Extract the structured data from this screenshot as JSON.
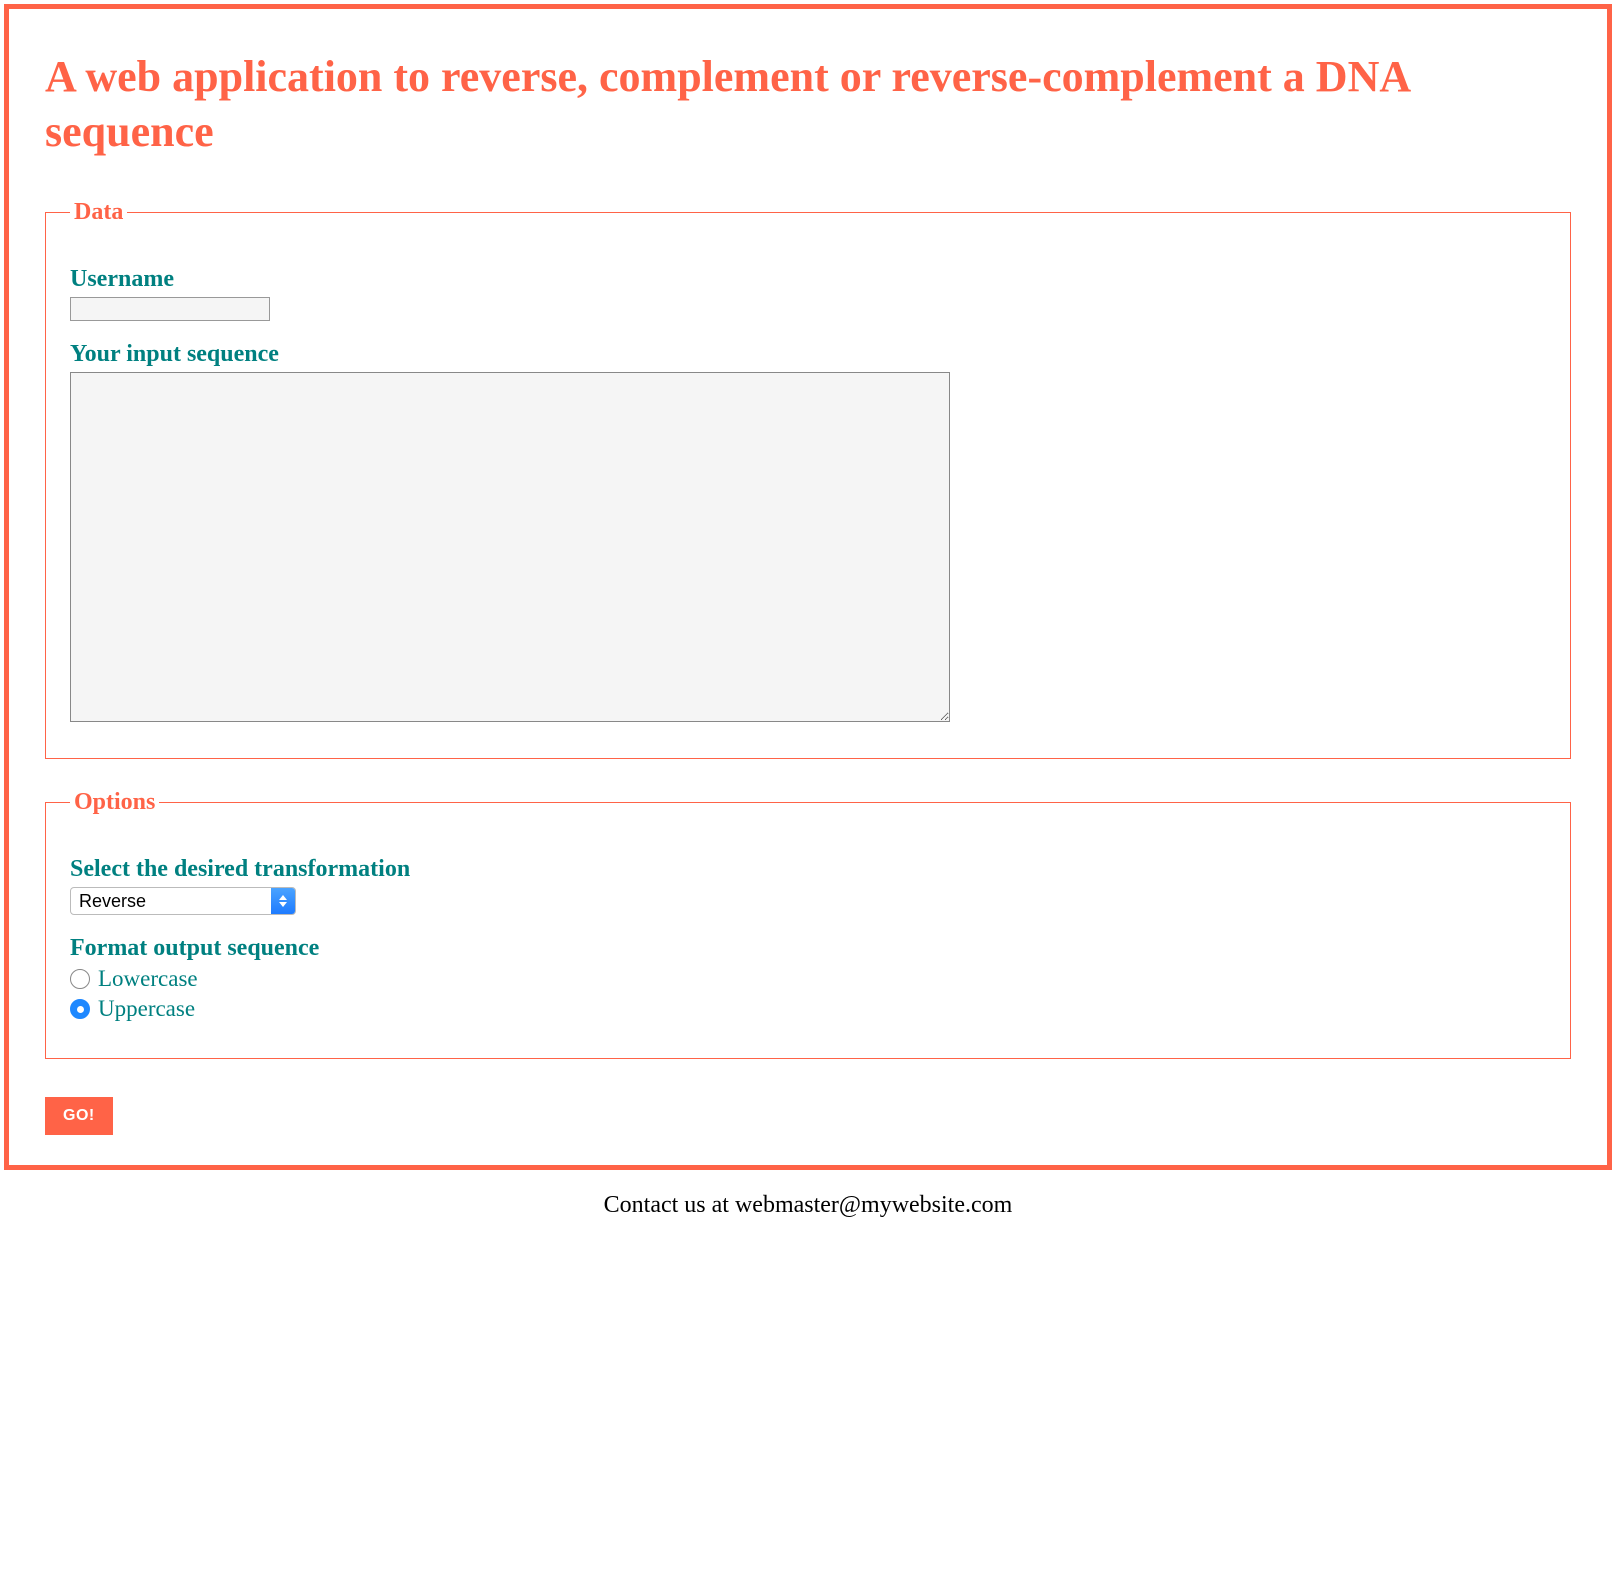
{
  "header": {
    "title": "A web application to reverse, complement or reverse-complement a DNA sequence"
  },
  "data_section": {
    "legend": "Data",
    "username_label": "Username",
    "username_value": "",
    "sequence_label": "Your input sequence",
    "sequence_value": ""
  },
  "options_section": {
    "legend": "Options",
    "transform_label": "Select the desired transformation",
    "transform_selected": "Reverse",
    "format_label": "Format output sequence",
    "radios": [
      {
        "label": "Lowercase",
        "checked": false
      },
      {
        "label": "Uppercase",
        "checked": true
      }
    ]
  },
  "actions": {
    "go_label": "GO!"
  },
  "footer": {
    "text": "Contact us at webmaster@mywebsite.com"
  }
}
